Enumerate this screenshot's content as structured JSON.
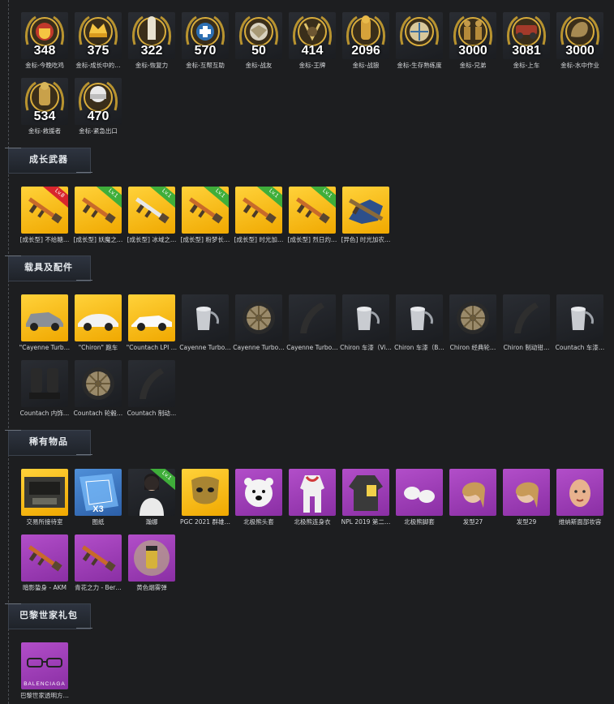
{
  "sections": {
    "weapons": "成长武器",
    "vehicles": "载具及配件",
    "rare": "稀有物品",
    "paris": "巴黎世家礼包"
  },
  "medals": [
    {
      "count": "348",
      "label": "金标-今晚吃鸡",
      "icon": "trophy-medal-icon"
    },
    {
      "count": "375",
      "label": "金标-成长中的…",
      "icon": "crown-medal-icon"
    },
    {
      "count": "322",
      "label": "金标-恢复力",
      "icon": "statue-medal-icon"
    },
    {
      "count": "570",
      "label": "金标-互帮互助",
      "icon": "medkit-medal-icon"
    },
    {
      "count": "50",
      "label": "金标-战友",
      "icon": "eagle-medal-icon"
    },
    {
      "count": "414",
      "label": "金标-王牌",
      "icon": "ace-medal-icon"
    },
    {
      "count": "2096",
      "label": "金标-战狼",
      "icon": "soldier-medal-icon"
    },
    {
      "count": "",
      "label": "金标-生存熟练度",
      "icon": "parachute-medal-icon"
    },
    {
      "count": "3000",
      "label": "金标-兄弟",
      "icon": "brothers-medal-icon"
    },
    {
      "count": "3081",
      "label": "金标-上车",
      "icon": "car-medal-icon"
    },
    {
      "count": "3000",
      "label": "金标-水中作业",
      "icon": "seal-medal-icon"
    },
    {
      "count": "534",
      "label": "金标-救援者",
      "icon": "rescuer-medal-icon"
    },
    {
      "count": "470",
      "label": "金标-紧急出口",
      "icon": "helmet-medal-icon"
    }
  ],
  "weapons": [
    {
      "label": "[成长型] 不给糖…",
      "ribbon": "Lv.8",
      "ribbon_color": "red",
      "icon": "rifle-icon"
    },
    {
      "label": "[成长型] 妖魔之…",
      "ribbon": "Lv.1",
      "ribbon_color": "green",
      "icon": "rifle-icon"
    },
    {
      "label": "[成长型] 冰域之…",
      "ribbon": "Lv.1",
      "ribbon_color": "green",
      "icon": "smg-icon"
    },
    {
      "label": "[成长型] 粉梦长…",
      "ribbon": "Lv.1",
      "ribbon_color": "green",
      "icon": "rifle-icon"
    },
    {
      "label": "[成长型] 时光加…",
      "ribbon": "Lv.1",
      "ribbon_color": "green",
      "icon": "rifle-icon"
    },
    {
      "label": "[成长型] 烈日灼…",
      "ribbon": "Lv.1",
      "ribbon_color": "green",
      "icon": "rifle-icon"
    },
    {
      "label": "[异色] 时光加农…",
      "ribbon": "",
      "ribbon_color": "",
      "icon": "map-rifle-icon"
    }
  ],
  "vehicles": [
    {
      "label": "\"Cayenne Turb…",
      "bg": "gold",
      "icon": "suv-icon"
    },
    {
      "label": "\"Chiron\" 跑车",
      "bg": "gold",
      "icon": "supercar-icon"
    },
    {
      "label": "\"Countach LPI …",
      "bg": "gold",
      "icon": "sportscar-icon"
    },
    {
      "label": "Cayenne Turbo…",
      "bg": "dark",
      "icon": "paint-bucket-icon"
    },
    {
      "label": "Cayenne Turbo…",
      "bg": "dark",
      "icon": "wheel-icon"
    },
    {
      "label": "Cayenne Turbo…",
      "bg": "dark",
      "icon": "brake-caliper-icon"
    },
    {
      "label": "Chiron 车漆（Vi…",
      "bg": "dark",
      "icon": "paint-bucket-icon"
    },
    {
      "label": "Chiron 车漆（B…",
      "bg": "dark",
      "icon": "paint-bucket-icon"
    },
    {
      "label": "Chiron 经典轮…",
      "bg": "dark",
      "icon": "wheel-icon"
    },
    {
      "label": "Chiron 制动钳…",
      "bg": "dark",
      "icon": "brake-caliper-icon"
    },
    {
      "label": "Countach 车漆…",
      "bg": "dark",
      "icon": "paint-bucket-icon"
    },
    {
      "label": "Countach 内饰…",
      "bg": "dark",
      "icon": "car-seat-icon"
    },
    {
      "label": "Countach 轮毂…",
      "bg": "dark",
      "icon": "wheel-icon"
    },
    {
      "label": "Countach 制动…",
      "bg": "dark",
      "icon": "brake-caliper-icon"
    }
  ],
  "rare": [
    {
      "label": "交易所接待室",
      "bg": "gold",
      "icon": "room-icon",
      "extra": ""
    },
    {
      "label": "图纸",
      "bg": "blue",
      "icon": "blueprint-icon",
      "extra": "X3"
    },
    {
      "label": "瀚娜",
      "bg": "dark",
      "icon": "character-icon",
      "extra": "Lv.1"
    },
    {
      "label": "PGC 2021 群雄…",
      "bg": "gold",
      "icon": "mask-icon",
      "extra": ""
    },
    {
      "label": "北极熊头套",
      "bg": "purple",
      "icon": "bear-head-icon",
      "extra": ""
    },
    {
      "label": "北极熊连身衣",
      "bg": "purple",
      "icon": "jumpsuit-icon",
      "extra": ""
    },
    {
      "label": "NPL 2019 第二…",
      "bg": "purple",
      "icon": "jacket-icon",
      "extra": ""
    },
    {
      "label": "北极熊脚套",
      "bg": "purple",
      "icon": "bear-feet-icon",
      "extra": ""
    },
    {
      "label": "发型27",
      "bg": "purple",
      "icon": "hair-icon",
      "extra": ""
    },
    {
      "label": "发型29",
      "bg": "purple",
      "icon": "hair-icon",
      "extra": ""
    },
    {
      "label": "维纳斯面部妆容",
      "bg": "purple",
      "icon": "face-icon",
      "extra": ""
    },
    {
      "label": "暗影蛰身 - AKM",
      "bg": "purple",
      "icon": "rifle-icon",
      "extra": ""
    },
    {
      "label": "青花之力 - Ber…",
      "bg": "purple",
      "icon": "rifle-icon",
      "extra": ""
    },
    {
      "label": "黄色烟雾弹",
      "bg": "purple",
      "icon": "smoke-grenade-icon",
      "extra": ""
    }
  ],
  "paris": [
    {
      "label": "巴黎世家透明方…",
      "bg": "purple",
      "icon": "sunglasses-icon",
      "brand": "BALENCIAGA"
    }
  ]
}
